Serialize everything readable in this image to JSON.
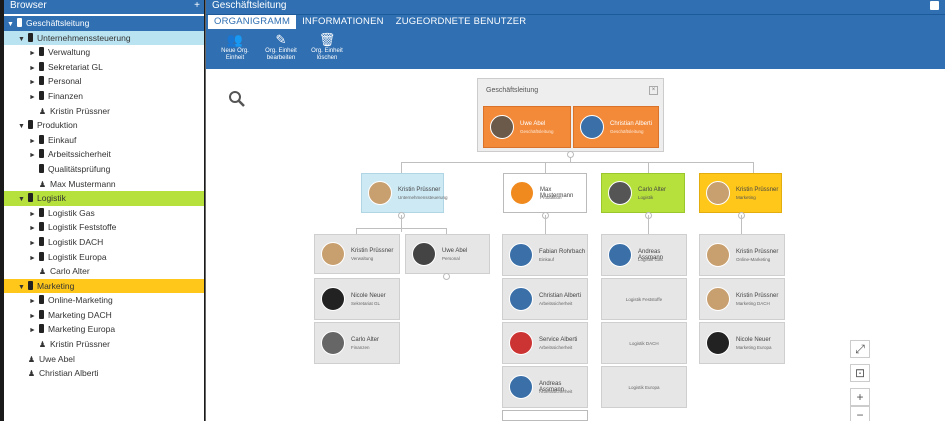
{
  "browser": {
    "title": "Browser",
    "add_label": "+",
    "items": [
      {
        "label": "Geschäftsleitung",
        "level": 0,
        "arrow": "▼",
        "type": "unit",
        "hl": "hl-sel"
      },
      {
        "label": "Unternehmenssteuerung",
        "level": 1,
        "arrow": "▼",
        "type": "unit",
        "hl": "hl-blue"
      },
      {
        "label": "Verwaltung",
        "level": 2,
        "arrow": "►",
        "type": "unit",
        "hl": ""
      },
      {
        "label": "Sekretariat GL",
        "level": 2,
        "arrow": "►",
        "type": "unit",
        "hl": ""
      },
      {
        "label": "Personal",
        "level": 2,
        "arrow": "►",
        "type": "unit",
        "hl": ""
      },
      {
        "label": "Finanzen",
        "level": 2,
        "arrow": "►",
        "type": "unit",
        "hl": ""
      },
      {
        "label": "Kristin Prüssner",
        "level": 2,
        "arrow": "",
        "type": "person",
        "hl": ""
      },
      {
        "label": "Produktion",
        "level": 1,
        "arrow": "▼",
        "type": "unit",
        "hl": ""
      },
      {
        "label": "Einkauf",
        "level": 2,
        "arrow": "►",
        "type": "unit",
        "hl": ""
      },
      {
        "label": "Arbeitssicherheit",
        "level": 2,
        "arrow": "►",
        "type": "unit",
        "hl": ""
      },
      {
        "label": "Qualitätsprüfung",
        "level": 2,
        "arrow": "",
        "type": "unit",
        "hl": ""
      },
      {
        "label": "Max Mustermann",
        "level": 2,
        "arrow": "",
        "type": "person",
        "hl": ""
      },
      {
        "label": "Logistik",
        "level": 1,
        "arrow": "▼",
        "type": "unit",
        "hl": "hl-green"
      },
      {
        "label": "Logistik Gas",
        "level": 2,
        "arrow": "►",
        "type": "unit",
        "hl": ""
      },
      {
        "label": "Logistik Feststoffe",
        "level": 2,
        "arrow": "►",
        "type": "unit",
        "hl": ""
      },
      {
        "label": "Logistik DACH",
        "level": 2,
        "arrow": "►",
        "type": "unit",
        "hl": ""
      },
      {
        "label": "Logistik Europa",
        "level": 2,
        "arrow": "►",
        "type": "unit",
        "hl": ""
      },
      {
        "label": "Carlo Alter",
        "level": 2,
        "arrow": "",
        "type": "person",
        "hl": ""
      },
      {
        "label": "Marketing",
        "level": 1,
        "arrow": "▼",
        "type": "unit",
        "hl": "hl-yellow"
      },
      {
        "label": "Online-Marketing",
        "level": 2,
        "arrow": "►",
        "type": "unit",
        "hl": ""
      },
      {
        "label": "Marketing DACH",
        "level": 2,
        "arrow": "►",
        "type": "unit",
        "hl": ""
      },
      {
        "label": "Marketing Europa",
        "level": 2,
        "arrow": "►",
        "type": "unit",
        "hl": ""
      },
      {
        "label": "Kristin Prüssner",
        "level": 2,
        "arrow": "",
        "type": "person",
        "hl": ""
      },
      {
        "label": "Uwe Abel",
        "level": 1,
        "arrow": "",
        "type": "person",
        "hl": ""
      },
      {
        "label": "Christian Alberti",
        "level": 1,
        "arrow": "",
        "type": "person",
        "hl": ""
      }
    ]
  },
  "main": {
    "title": "Geschäftsleitung",
    "tabs": [
      {
        "label": "ORGANIGRAMM",
        "active": true
      },
      {
        "label": "INFORMATIONEN",
        "active": false
      },
      {
        "label": "ZUGEORDNETE BENUTZER",
        "active": false
      }
    ],
    "toolbar": [
      {
        "icon": "users-add-icon",
        "glyph": "👥",
        "label1": "Neue Org.",
        "label2": "Einheit"
      },
      {
        "icon": "pencil-icon",
        "glyph": "✎",
        "label1": "Org. Einheit",
        "label2": "bearbeiten"
      },
      {
        "icon": "trash-icon",
        "glyph": "🗑",
        "label1": "Org. Einheit",
        "label2": "löschen"
      }
    ]
  },
  "org": {
    "root_title": "Geschäftsleitung",
    "root_close": "×",
    "root_cards": [
      {
        "name": "Uwe Abel",
        "role": "Geschäftsleitung"
      },
      {
        "name": "Christian Alberti",
        "role": "Geschäftsleitung"
      }
    ],
    "level1": [
      {
        "name": "Kristin Prüssner",
        "role": "Unternehmenssteuerung"
      },
      {
        "name": "Max Mustermann",
        "role": "Produktion"
      },
      {
        "name": "Carlo Alter",
        "role": "Logistik"
      },
      {
        "name": "Kristin Prüssner",
        "role": "Marketing"
      }
    ],
    "col1": [
      {
        "name": "Kristin Prüssner",
        "role": "Verwaltung"
      },
      {
        "name": "Uwe Abel",
        "role": "Personal"
      },
      {
        "name": "Nicole Neuer",
        "role": "Sekretariat GL"
      },
      {
        "name": "Carlo Alter",
        "role": "Finanzen"
      }
    ],
    "col2": [
      {
        "name": "Fabian Rohrbach",
        "role": "Einkauf"
      },
      {
        "name": "Christian Alberti",
        "role": "Arbeitssicherheit"
      },
      {
        "name": "Service Alberti",
        "role": "Arbeitssicherheit"
      },
      {
        "name": "Andreas Assmann",
        "role": "Arbeitssicherheit"
      }
    ],
    "col3": [
      {
        "name": "Andreas Assmann",
        "role": "Logistik Gas"
      },
      {
        "name": "",
        "role": "Logistik Feststoffe"
      },
      {
        "name": "",
        "role": "Logistik DACH"
      },
      {
        "name": "",
        "role": "Logistik Europa"
      }
    ],
    "col4": [
      {
        "name": "Kristin Prüssner",
        "role": "Online-Marketing"
      },
      {
        "name": "Kristin Prüssner",
        "role": "Marketing DACH"
      },
      {
        "name": "Nicole Neuer",
        "role": "Marketing Europa"
      }
    ]
  },
  "zoom_controls": {
    "fit": "⤢",
    "center": "⊡",
    "in": "+",
    "out": "−"
  },
  "colors": {
    "header": "#2f6fb2",
    "blue": "#cde9f4",
    "green": "#b6e03b",
    "yellow": "#ffc71a",
    "orange": "#f28a3a"
  }
}
